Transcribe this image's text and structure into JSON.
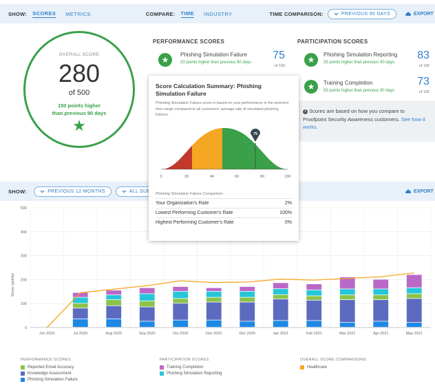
{
  "topbar": {
    "show_label": "SHOW:",
    "tab_scores": "SCORES",
    "tab_metrics": "METRICS",
    "compare_label": "COMPARE:",
    "tab_time": "TIME",
    "tab_industry": "INDUSTRY",
    "timecomp_label": "TIME COMPARISON:",
    "timecomp_value": "PREVIOUS 90 DAYS",
    "export": "EXPORT"
  },
  "overall": {
    "label": "OVERALL SCORE",
    "score": "280",
    "of": "of 500",
    "delta_line1": "150 points higher",
    "delta_line2": "than previous 90 days"
  },
  "performance": {
    "title": "PERFORMANCE SCORES",
    "items": [
      {
        "name": "Phishing Simulation Failure",
        "sub": "33 points higher than previous 90 days",
        "score": "75",
        "of": "of 100"
      }
    ]
  },
  "participation": {
    "title": "PARTICIPATION SCORES",
    "items": [
      {
        "name": "Phishing Simulation Reporting",
        "sub": "35 points higher than previous 90 days",
        "score": "83",
        "of": "of 100"
      },
      {
        "name": "Training Completion",
        "sub": "55 points higher than previous 90 days",
        "score": "73",
        "of": "of 100"
      }
    ]
  },
  "info": {
    "text": "Scores are based on how you compare to Proofpoint Security Awareness customers.",
    "link": "See how it works."
  },
  "popup": {
    "title": "Score Calculation Summary: Phishing Simulation Failure",
    "desc": "Phishing Simulation Failure score is based on your performance in the selected time range compared to all customers' average rate of simulated phishing failures.",
    "marker": "75",
    "axis": [
      "0",
      "20",
      "40",
      "60",
      "80",
      "100"
    ],
    "comparison_title": "Phishing Simulation Failure Comparison",
    "rows": [
      {
        "label": "Your Organization's Rate",
        "value": "2%"
      },
      {
        "label": "Lowest Performing Customer's Rate",
        "value": "100%"
      },
      {
        "label": "Highest Performing Customer's Rate",
        "value": "0%"
      }
    ]
  },
  "bottombar": {
    "show_label": "SHOW:",
    "range": "PREVIOUS 12 MONTHS",
    "filter": "ALL SUBSCR",
    "export": "EXPORT"
  },
  "colors": {
    "reported_email_accuracy": "#8bc34a",
    "knowledge_assessment": "#5c6bc0",
    "phishing_simulation_failure": "#1e88e5",
    "training_completion": "#ba68c8",
    "phishing_simulation_reporting": "#26c6da",
    "healthcare": "#f5a623"
  },
  "chart_data": {
    "type": "bar",
    "ylabel": "Score (points)",
    "ylim": [
      0,
      500
    ],
    "yticks": [
      "0",
      "100",
      "200",
      "300",
      "400",
      "500"
    ],
    "categories": [
      "Jun 2020",
      "Jul 2020",
      "Aug 2020",
      "Sep 2020",
      "Oct 2020",
      "Nov 2020",
      "Dec 2020",
      "Jan 2021",
      "Feb 2021",
      "Mar 2021",
      "Apr 2021",
      "May 2021"
    ],
    "series": [
      {
        "name": "Phishing Simulation Failure",
        "values": [
          0,
          35,
          35,
          25,
          30,
          30,
          25,
          28,
          28,
          20,
          25,
          20
        ]
      },
      {
        "name": "Knowledge Assessment",
        "values": [
          0,
          45,
          55,
          60,
          70,
          75,
          80,
          90,
          85,
          95,
          90,
          100
        ]
      },
      {
        "name": "Reported Email Accuracy",
        "values": [
          0,
          20,
          25,
          25,
          20,
          20,
          20,
          18,
          18,
          20,
          20,
          20
        ]
      },
      {
        "name": "Phishing Simulation Reporting",
        "values": [
          0,
          25,
          20,
          30,
          30,
          25,
          25,
          25,
          25,
          25,
          25,
          25
        ]
      },
      {
        "name": "Training Completion",
        "values": [
          0,
          20,
          20,
          25,
          20,
          15,
          20,
          25,
          25,
          50,
          40,
          55
        ]
      },
      {
        "name": "Healthcare",
        "type": "line",
        "values": [
          0,
          145,
          160,
          175,
          195,
          188,
          190,
          202,
          198,
          205,
          212,
          228
        ]
      }
    ]
  },
  "legend": {
    "performance_title": "PERFORMANCE SCORES",
    "performance": [
      "Reported Email Accuracy",
      "Knowledge Assessment",
      "Phishing Simulation Failure"
    ],
    "participation_title": "PARTICIPATION SCORES",
    "participation": [
      "Training Completion",
      "Phishing Simulation Reporting"
    ],
    "comparison_title": "OVERALL SCORE COMPARISONS",
    "comparison": [
      "Healthcare"
    ]
  }
}
